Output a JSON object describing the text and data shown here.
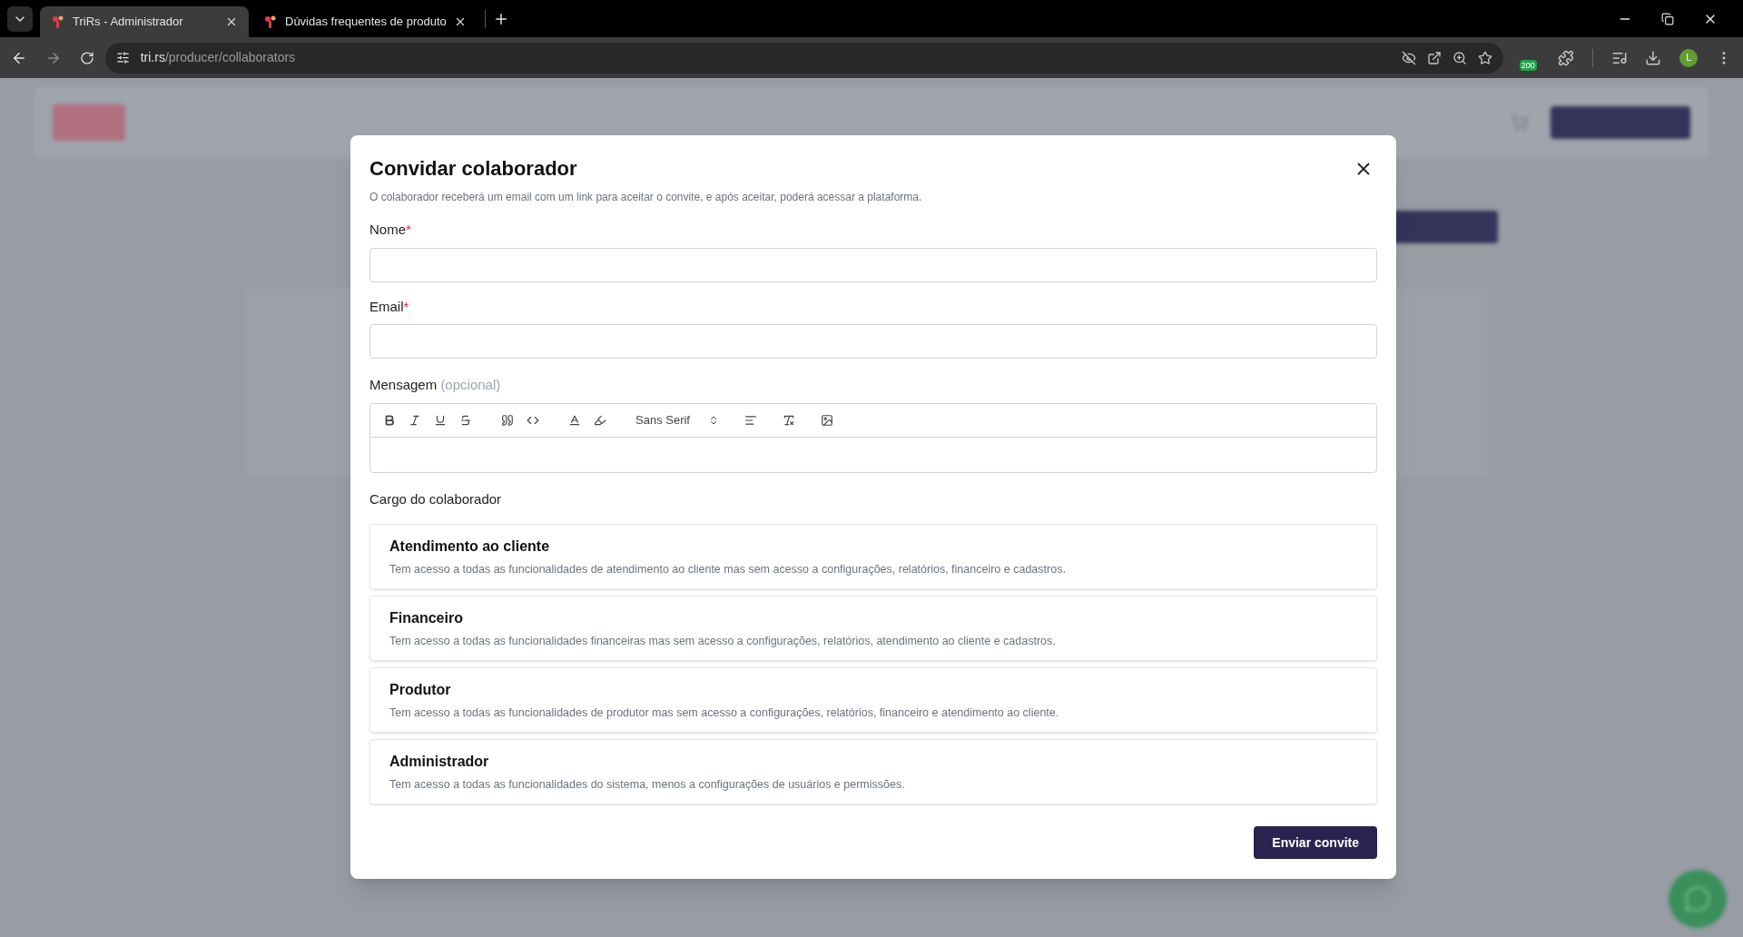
{
  "browser": {
    "tabs": [
      {
        "title": "TriRs - Administrador",
        "selected": true
      },
      {
        "title": "Dúvidas frequentes de produto",
        "selected": false
      }
    ],
    "url": {
      "host": "tri.rs",
      "path": "/producer/collaborators"
    },
    "extension_badge": "200",
    "profile": "L"
  },
  "modal": {
    "title": "Convidar colaborador",
    "description": "O colaborador receberá um email com um link para aceitar o convite, e após aceitar, poderá acessar a plataforma.",
    "fields": [
      {
        "label": "Nome",
        "required_mark": "*"
      },
      {
        "label": "Email",
        "required_mark": "*"
      }
    ],
    "message": {
      "label": "Mensagem",
      "hint": "(opcional)",
      "font": "Sans Serif"
    },
    "roles_label": "Cargo do colaborador",
    "roles": [
      {
        "title": "Atendimento ao cliente",
        "description": "Tem acesso a todas as funcionalidades de atendimento ao cliente mas sem acesso a configurações, relatórios, financeiro e cadastros."
      },
      {
        "title": "Financeiro",
        "description": "Tem acesso a todas as funcionalidades financeiras mas sem acesso a configurações, relatórios, atendimento ao cliente e cadastros."
      },
      {
        "title": "Produtor",
        "description": "Tem acesso a todas as funcionalidades de produtor mas sem acesso a configurações, relatórios, financeiro e atendimento ao cliente."
      },
      {
        "title": "Administrador",
        "description": "Tem acesso a todas as funcionalidades do sistema, menos a configurações de usuários e permissões."
      }
    ],
    "submit": "Enviar convite"
  }
}
